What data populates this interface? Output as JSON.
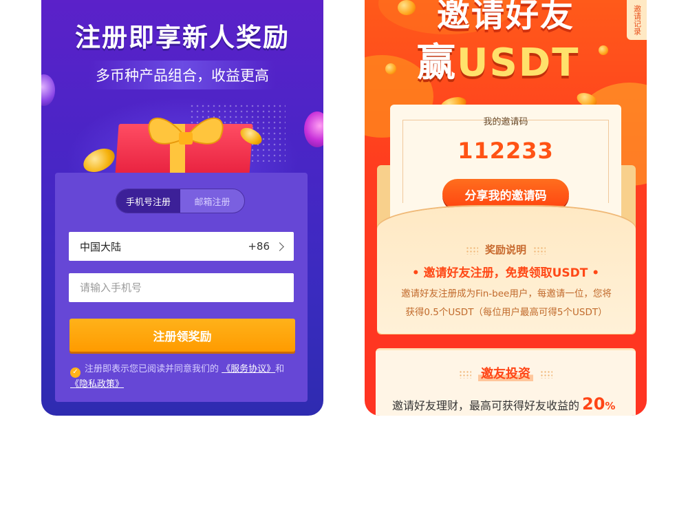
{
  "register": {
    "title": "注册即享新人奖励",
    "subtitle": "多币种产品组合，收益更高",
    "tabs": [
      {
        "label": "手机号注册",
        "active": true
      },
      {
        "label": "邮箱注册",
        "active": false
      }
    ],
    "region": {
      "label": "中国大陆",
      "code": "+86"
    },
    "phone_placeholder": "请输入手机号",
    "phone_value": "",
    "submit_label": "注册领奖励",
    "agreement": {
      "checked": true,
      "prefix": "注册即表示您已阅读并同意我们的",
      "service_link": "《服务协议》",
      "and": "和",
      "privacy_link": "《隐私政策》"
    }
  },
  "invite": {
    "hero_line1": "邀请好友",
    "hero_line2_prefix": "赢",
    "hero_line2_highlight": "USDT",
    "records_tab": "邀请记录",
    "code_label": "我的邀请码",
    "code": "112233",
    "share_label": "分享我的邀请码",
    "reward_title": "奖励说明",
    "reward_line": "•  邀请好友注册，免费领取USDT  •",
    "reward_desc_1": "邀请好友注册成为Fin-bee用户，每邀请一位，您将",
    "reward_desc_2": "获得0.5个USDT（每位用户最高可得5个USDT）",
    "invest_title": "邀友投资",
    "invest_line": "邀请好友理财，最高可获得好友收益的",
    "invest_pct_value": "20",
    "invest_pct_unit": "%"
  },
  "colors": {
    "left_bg": "#4a25c6",
    "panel": "#6647d6",
    "accent_orange": "#ffa10c",
    "right_bg": "#ff3d1f",
    "invite_red": "#ff4816"
  },
  "icons": [
    "chevron-right-icon",
    "check-circle-icon",
    "gift-box-icon",
    "coin-icon"
  ]
}
